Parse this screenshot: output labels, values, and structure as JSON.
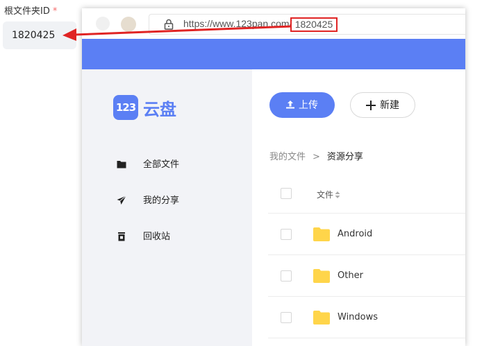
{
  "form": {
    "label": "根文件夹ID",
    "required_mark": "*",
    "value": "1820425"
  },
  "browser": {
    "url_prefix": "https://www.123pan.com/",
    "url_id": "1820425"
  },
  "sidebar": {
    "logo_mark": "123",
    "logo_text": "云盘",
    "items": [
      {
        "label": "全部文件",
        "icon": "folder-icon"
      },
      {
        "label": "我的分享",
        "icon": "paper-plane-icon"
      },
      {
        "label": "回收站",
        "icon": "trash-icon"
      }
    ]
  },
  "toolbar": {
    "upload_label": "上传",
    "new_label": "新建"
  },
  "breadcrumb": {
    "root": "我的文件",
    "separator": ">",
    "current": "资源分享"
  },
  "table": {
    "column_header": "文件",
    "rows": [
      {
        "name": "Android"
      },
      {
        "name": "Other"
      },
      {
        "name": "Windows"
      }
    ]
  },
  "colors": {
    "brand_blue": "#5b7ff4",
    "annotation_red": "#e02424"
  }
}
